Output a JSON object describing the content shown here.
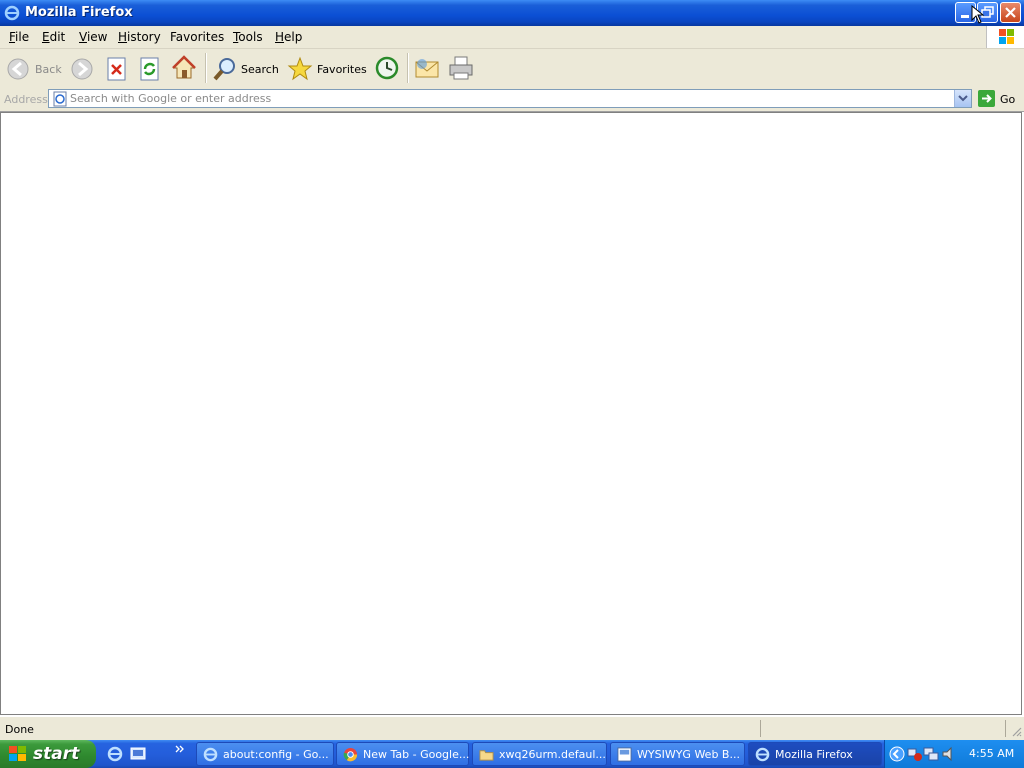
{
  "window": {
    "title": "Mozilla Firefox"
  },
  "menu": [
    {
      "key": "F",
      "rest": "ile"
    },
    {
      "key": "E",
      "rest": "dit"
    },
    {
      "key": "V",
      "rest": "iew"
    },
    {
      "key": "H",
      "rest": "istory"
    },
    {
      "key": "",
      "rest": "Favorites"
    },
    {
      "key": "T",
      "rest": "ools"
    },
    {
      "key": "H",
      "rest": "elp"
    }
  ],
  "toolbar": {
    "back_label": "Back",
    "search_label": "Search",
    "favorites_label": "Favorites"
  },
  "address": {
    "label": "Address",
    "placeholder": "Search with Google or enter address",
    "go_label": "Go"
  },
  "status": {
    "text": "Done"
  },
  "taskbar": {
    "start_label": "start",
    "tasks": [
      {
        "label": "about:config - Go..."
      },
      {
        "label": "New Tab - Google..."
      },
      {
        "label": "xwq26urm.defaul..."
      },
      {
        "label": "WYSIWYG Web B..."
      },
      {
        "label": "Mozilla Firefox"
      }
    ],
    "clock": "4:55 AM"
  }
}
